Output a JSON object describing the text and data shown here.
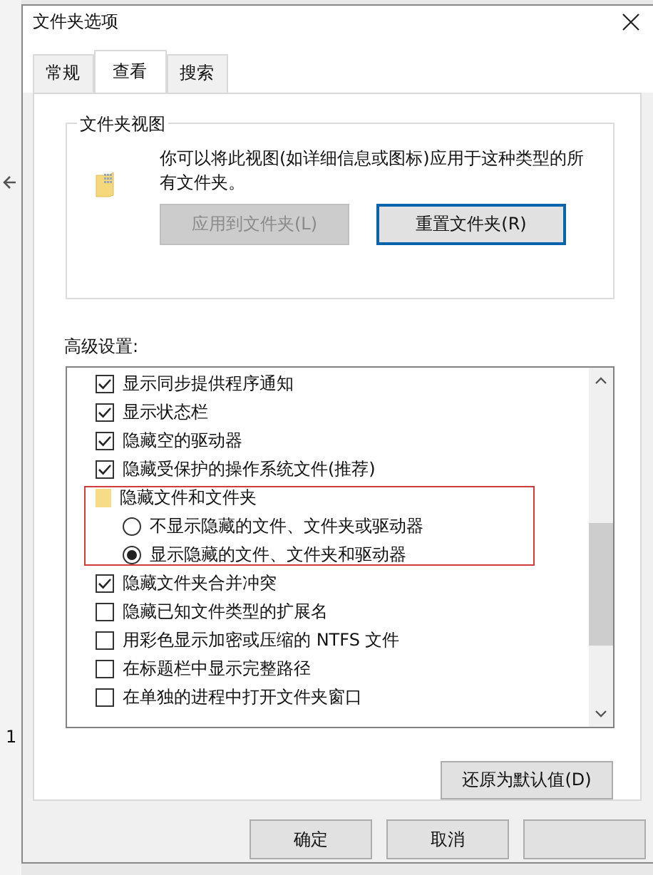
{
  "background_window": {
    "texts": [
      "1"
    ]
  },
  "window": {
    "title": "文件夹选项"
  },
  "tabs": [
    {
      "label": "常规",
      "selected": false
    },
    {
      "label": "查看",
      "selected": true
    },
    {
      "label": "搜索",
      "selected": false
    }
  ],
  "folder_view": {
    "title": "文件夹视图",
    "description": "你可以将此视图(如详细信息或图标)应用于这种类型的所有文件夹。",
    "buttons": [
      {
        "label": "应用到文件夹(L)",
        "disabled": true,
        "focused": false
      },
      {
        "label": "重置文件夹(R)",
        "disabled": false,
        "focused": true
      }
    ]
  },
  "advanced": {
    "label": "高级设置:",
    "items": [
      {
        "kind": "checkbox",
        "label": "显示同步提供程序通知",
        "checked": true
      },
      {
        "kind": "checkbox",
        "label": "显示状态栏",
        "checked": true
      },
      {
        "kind": "checkbox",
        "label": "隐藏空的驱动器",
        "checked": true
      },
      {
        "kind": "checkbox",
        "label": "隐藏受保护的操作系统文件(推荐)",
        "checked": true
      },
      {
        "kind": "folder",
        "label": "隐藏文件和文件夹",
        "children": [
          {
            "kind": "radio",
            "label": "不显示隐藏的文件、文件夹或驱动器",
            "selected": false
          },
          {
            "kind": "radio",
            "label": "显示隐藏的文件、文件夹和驱动器",
            "selected": true
          }
        ]
      },
      {
        "kind": "checkbox",
        "label": "隐藏文件夹合并冲突",
        "checked": true
      },
      {
        "kind": "checkbox",
        "label": "隐藏已知文件类型的扩展名",
        "checked": false
      },
      {
        "kind": "checkbox",
        "label": "用彩色显示加密或压缩的 NTFS 文件",
        "checked": false
      },
      {
        "kind": "checkbox",
        "label": "在标题栏中显示完整路径",
        "checked": false
      },
      {
        "kind": "checkbox",
        "label": "在单独的进程中打开文件夹窗口",
        "checked": false
      }
    ]
  },
  "restore_button": "还原为默认值(D)",
  "footer_buttons": [
    "确定",
    "取消"
  ]
}
